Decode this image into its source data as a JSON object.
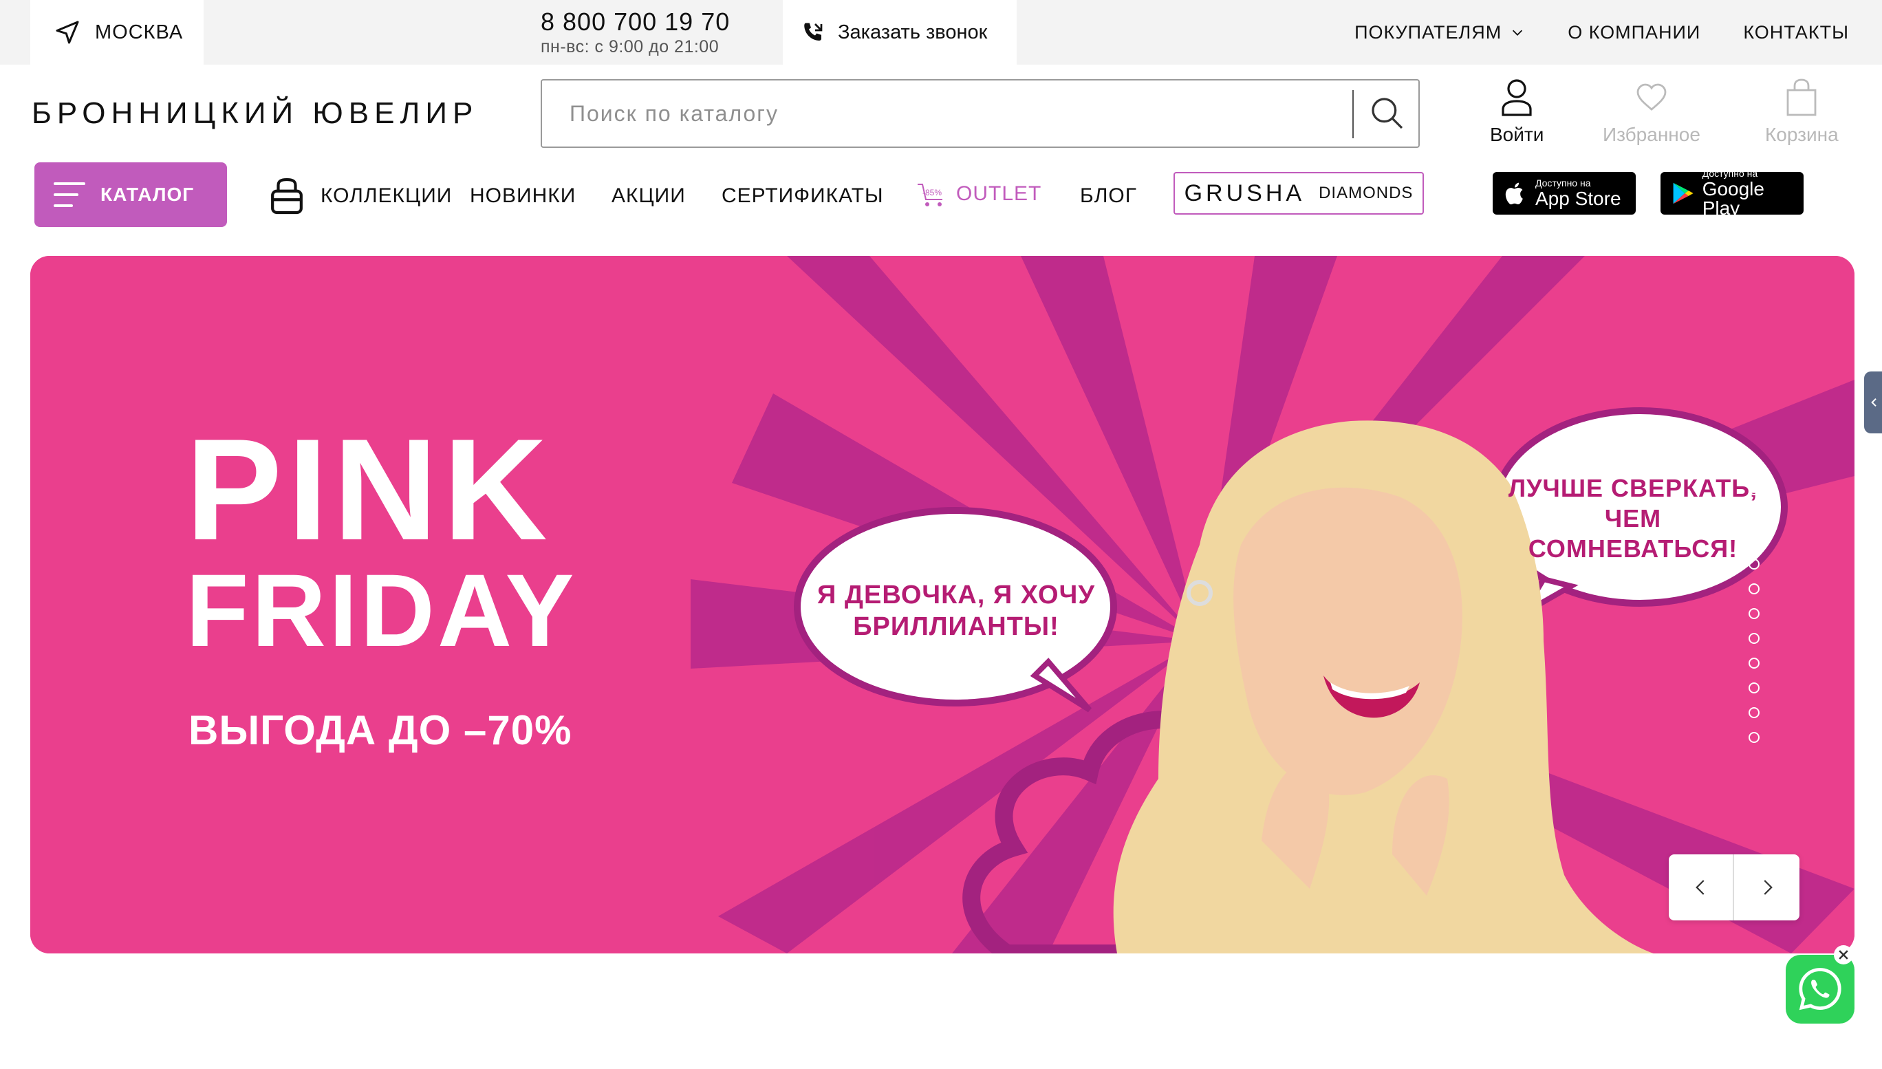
{
  "topbar": {
    "city": "МОСКВА",
    "phone": "8 800 700 19 70",
    "hours": "пн-вс: с 9:00 до 21:00",
    "callback": "Заказать звонок",
    "nav": [
      "ПОКУПАТЕЛЯМ",
      "О КОМПАНИИ",
      "КОНТАКТЫ"
    ]
  },
  "header": {
    "logo": "БРОННИЦКИЙ ЮВЕЛИР",
    "search_placeholder": "Поиск по каталогу",
    "login": "Войти",
    "favorites": "Избранное",
    "cart": "Корзина"
  },
  "nav": {
    "catalog": "КАТАЛОГ",
    "collections": "КОЛЛЕКЦИИ",
    "new": "НОВИНКИ",
    "sales": "АКЦИИ",
    "certificates": "СЕРТИФИКАТЫ",
    "outlet_badge": "-85%",
    "outlet": "OUTLET",
    "blog": "БЛОГ",
    "grusha_main": "GRUSHA",
    "grusha_sub": "DIAMONDS"
  },
  "apps": {
    "appstore_small": "Доступно на",
    "appstore_big": "App Store",
    "gplay_small": "Доступно на",
    "gplay_big": "Google Play"
  },
  "banner": {
    "title_line1": "PINK",
    "title_line2": "FRIDAY",
    "subtitle": "ВЫГОДА ДО –70%",
    "bubble1": "Я ДЕВОЧКА, Я ХОЧУ БРИЛЛИАНТЫ!",
    "bubble2": "ЛУЧШЕ СВЕРКАТЬ, ЧЕМ СОМНЕВАТЬСЯ!",
    "slides_total": 12,
    "active_slide": 1
  },
  "colors": {
    "accent": "#c15bbc",
    "banner_bg": "#ea3f8d",
    "whatsapp": "#2fd25a"
  }
}
